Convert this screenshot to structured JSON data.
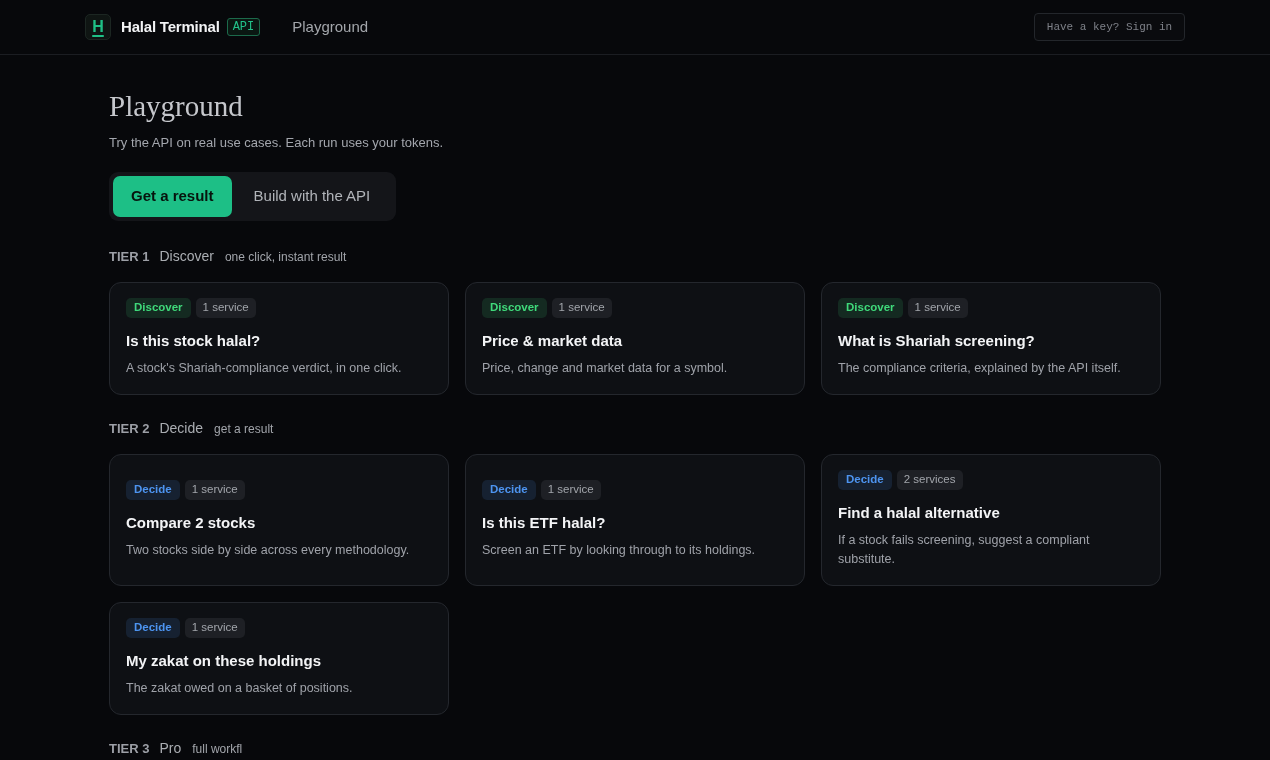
{
  "header": {
    "logo_letter": "H",
    "brand": "Halal Terminal",
    "badge": "API",
    "nav_links": [
      "Playground"
    ],
    "sign_in_button": "Have a key? Sign in"
  },
  "page": {
    "title": "Playground",
    "subtitle": "Try the API on real use cases. Each run uses your tokens."
  },
  "mode_tabs": [
    {
      "label": "Get a result",
      "selected": true
    },
    {
      "label": "Build with the API",
      "selected": false
    }
  ],
  "tiers": [
    {
      "label": "TIER 1",
      "name": "Discover",
      "hint": "one click, instant result",
      "cards": [
        {
          "tag": {
            "label": "Discover",
            "color": "#3fd97a"
          },
          "services": "1 service",
          "title": "Is this stock halal?",
          "description": "A stock's Shariah-compliance verdict, in one click."
        },
        {
          "tag": {
            "label": "Discover",
            "color": "#3fd97a"
          },
          "services": "1 service",
          "title": "Price & market data",
          "description": "Price, change and market data for a symbol."
        },
        {
          "tag": {
            "label": "Discover",
            "color": "#3fd97a"
          },
          "services": "1 service",
          "title": "What is Shariah screening?",
          "description": "The compliance criteria, explained by the API itself."
        }
      ]
    },
    {
      "label": "TIER 2",
      "name": "Decide",
      "hint": "get a result",
      "cards": [
        {
          "tag": {
            "label": "Decide",
            "color": "#4d94f0"
          },
          "services": "1 service",
          "title": "Compare 2 stocks",
          "description": "Two stocks side by side across every methodology."
        },
        {
          "tag": {
            "label": "Decide",
            "color": "#4d94f0"
          },
          "services": "1 service",
          "title": "Is this ETF halal?",
          "description": "Screen an ETF by looking through to its holdings."
        },
        {
          "tag": {
            "label": "Decide",
            "color": "#4d94f0"
          },
          "services": "2 services",
          "title": "Find a halal alternative",
          "description": "If a stock fails screening, suggest a compliant substitute."
        },
        {
          "tag": {
            "label": "Decide",
            "color": "#4d94f0"
          },
          "services": "1 service",
          "title": "My zakat on these holdings",
          "description": "The zakat owed on a basket of positions."
        }
      ]
    },
    {
      "label": "TIER 3",
      "name": "Pro",
      "hint": "full workfl"
    }
  ]
}
